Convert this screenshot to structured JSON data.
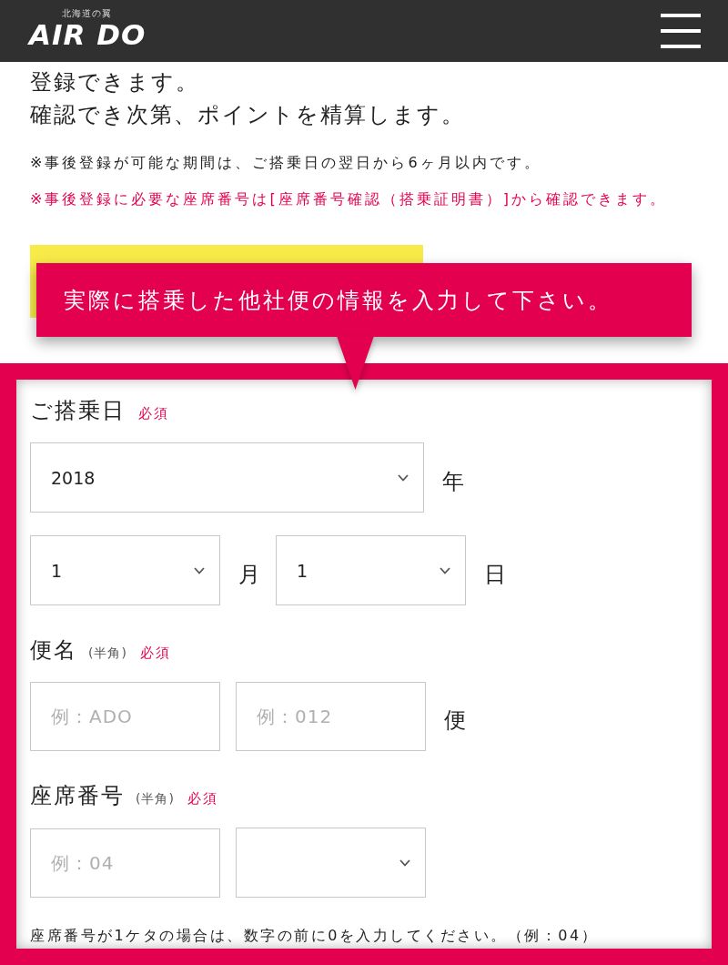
{
  "header": {
    "logo_tagline": "北海道の翼",
    "logo": "AIR DO"
  },
  "intro": {
    "lines": [
      "登録できます。",
      "確認でき次第、ポイントを精算します。"
    ],
    "notes": [
      {
        "kind": "info",
        "text": "※事後登録が可能な期間は、ご搭乗日の翌日から6ヶ月以内です。"
      },
      {
        "kind": "alert",
        "text": "※事後登録に必要な座席番号は[座席番号確認（搭乗証明書）]から確認できます。"
      }
    ]
  },
  "callout": {
    "text": "実際に搭乗した他社便の情報を入力して下さい。"
  },
  "form": {
    "sections": [
      {
        "label": "ご搭乗日",
        "required": "必須",
        "rows": [
          {
            "items": [
              {
                "kind": "select",
                "value": "2018"
              },
              {
                "kind": "unit",
                "text": "年"
              }
            ]
          },
          {
            "items": [
              {
                "kind": "select",
                "value": "1"
              },
              {
                "kind": "unit",
                "text": "月"
              },
              {
                "kind": "select",
                "value": "1"
              },
              {
                "kind": "unit",
                "text": "日"
              }
            ]
          }
        ]
      },
      {
        "label": "便名",
        "hint": "(半角)",
        "required": "必須",
        "rows": [
          {
            "items": [
              {
                "kind": "input",
                "placeholder": "例：ADO"
              },
              {
                "kind": "input",
                "placeholder": "例：012"
              },
              {
                "kind": "unit",
                "text": "便"
              }
            ]
          }
        ]
      },
      {
        "label": "座席番号",
        "hint": "(半角)",
        "required": "必須",
        "rows": [
          {
            "items": [
              {
                "kind": "input",
                "placeholder": "例：04"
              },
              {
                "kind": "select"
              }
            ]
          }
        ]
      }
    ],
    "footnote": "座席番号が1ケタの場合は、数字の前に0を入力してください。（例：04）"
  }
}
